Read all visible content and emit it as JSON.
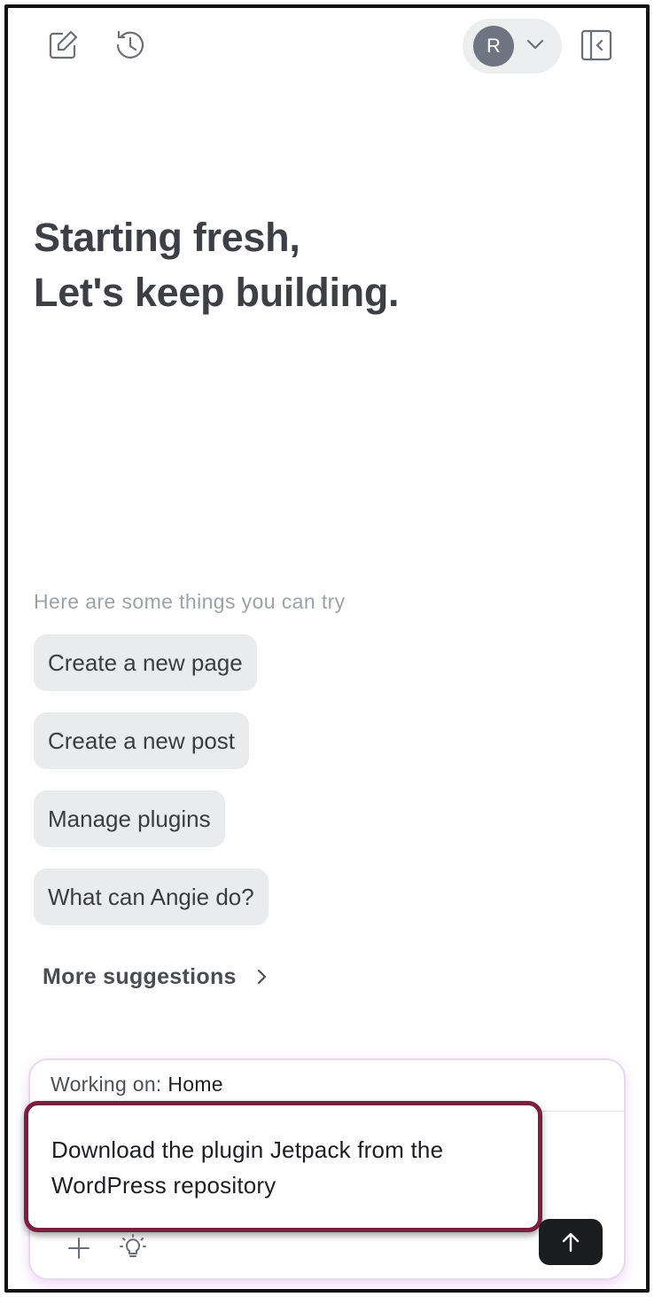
{
  "header": {
    "new_chat_icon": "edit-icon",
    "history_icon": "history-icon",
    "user_initial": "R",
    "collapse_icon": "sidebar-collapse-icon"
  },
  "hero": {
    "line1": "Starting fresh,",
    "line2": "Let's keep building."
  },
  "suggestions": {
    "label": "Here are some things you can try",
    "items": [
      "Create a new page",
      "Create a new post",
      "Manage plugins",
      "What can Angie do?"
    ],
    "more_label": "More suggestions"
  },
  "composer": {
    "working_prefix": "Working on:",
    "working_context": "Home",
    "prompt_text": "Download the plugin Jetpack from the WordPress repository",
    "highlight_color": "#7c1f3f"
  }
}
